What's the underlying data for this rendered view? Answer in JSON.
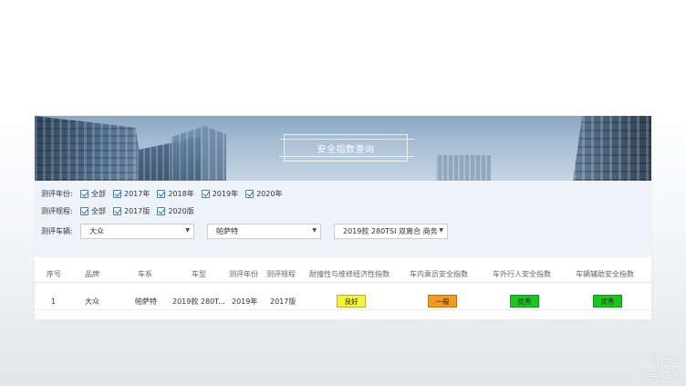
{
  "banner": {
    "title": "安全指数查询"
  },
  "filters": {
    "year": {
      "label": "测评年份:",
      "options": [
        "全部",
        "2017年",
        "2018年",
        "2019年",
        "2020年"
      ]
    },
    "regulation": {
      "label": "测评规程:",
      "options": [
        "全部",
        "2017版",
        "2020版"
      ]
    },
    "vehicle": {
      "label": "测评车辆:",
      "brand": "大众",
      "series": "帕萨特",
      "model": "2019款 280TSI 双离合 商务"
    }
  },
  "table": {
    "headers": [
      "序号",
      "品牌",
      "车系",
      "车型",
      "测评年份",
      "测评规程",
      "耐撞性与维修经济性指数",
      "车内乘员安全指数",
      "车外行人安全指数",
      "车辆辅助安全指数"
    ],
    "rows": [
      {
        "index": "1",
        "brand": "大众",
        "series": "帕萨特",
        "model": "2019款 280T...",
        "year": "2019年",
        "regulation": "2017版",
        "crash": "良好",
        "occupant": "一般",
        "pedestrian": "优秀",
        "assist": "优秀"
      }
    ]
  },
  "rating_colors": {
    "良好": "#f5f23a",
    "一般": "#f59a1c",
    "优秀": "#19c81e"
  },
  "watermark": {
    "line1": "陆云生",
    "line2": "汽车之家"
  }
}
